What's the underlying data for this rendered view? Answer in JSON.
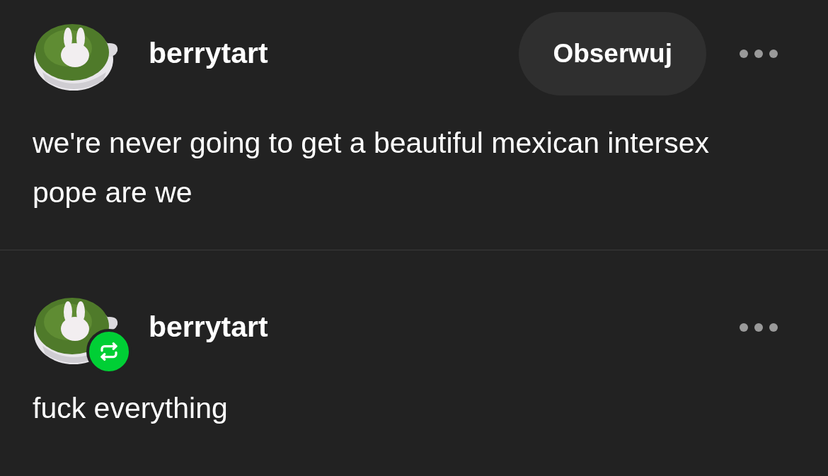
{
  "posts": [
    {
      "username": "berrytart",
      "follow_button": "Obserwuj",
      "reblogged": false,
      "text": "we're never going to get a beautiful mexican intersex pope are we"
    },
    {
      "username": "berrytart",
      "reblogged": true,
      "text": "fuck everything"
    }
  ]
}
